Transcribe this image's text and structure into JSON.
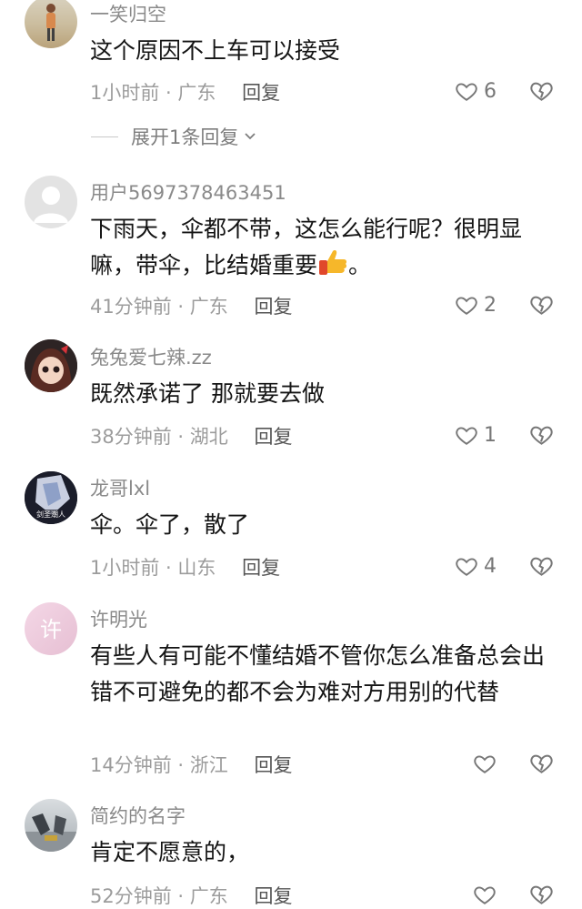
{
  "comments": [
    {
      "username": "一笑归空",
      "text": "这个原因不上车可以接受",
      "time": "1小时前",
      "location": "广东",
      "reply_label": "回复",
      "likes": "6",
      "expand_label": "展开1条回复"
    },
    {
      "username": "用户5697378463451",
      "text": "下雨天，伞都不带，这怎么能行呢？很明显嘛，带伞，比结婚重要",
      "text_tail": "。",
      "time": "41分钟前",
      "location": "广东",
      "reply_label": "回复",
      "likes": "2"
    },
    {
      "username": "兔兔爱七辣.zz",
      "text": "既然承诺了  那就要去做",
      "time": "38分钟前",
      "location": "湖北",
      "reply_label": "回复",
      "likes": "1"
    },
    {
      "username": "龙哥lxl",
      "text": "伞。伞了，散了",
      "time": "1小时前",
      "location": "山东",
      "reply_label": "回复",
      "likes": "4",
      "avatar_text": "剑圣潮人"
    },
    {
      "username": "许明光",
      "text": "有些人有可能不懂结婚不管你怎么准备总会出错不可避免的都不会为难对方用别的代替",
      "time": "14分钟前",
      "location": "浙江",
      "reply_label": "回复",
      "likes": "",
      "avatar_text": "许"
    },
    {
      "username": "简约的名字",
      "text": "肯定不愿意的，",
      "time": "52分钟前",
      "location": "广东",
      "reply_label": "回复",
      "likes": ""
    }
  ],
  "separator": " · ",
  "colors": {
    "text": "#141414",
    "meta": "#9c9c9c",
    "username": "#8a8a8a"
  },
  "icons": {
    "like": "heart-icon",
    "dislike": "broken-heart-icon",
    "expand": "chevron-down-icon",
    "emoji": "thumbs-up-emoji"
  }
}
